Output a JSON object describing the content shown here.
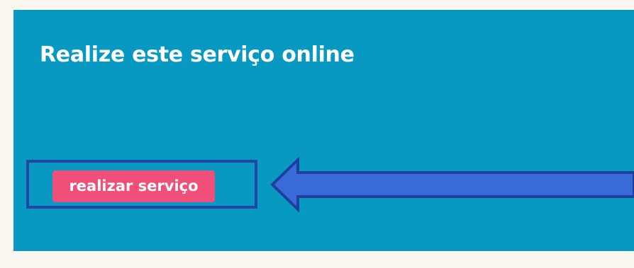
{
  "card": {
    "title": "Realize este serviço online",
    "background_color": "#0799c2"
  },
  "action": {
    "button_label": "realizar serviço",
    "button_color": "#ef4f78"
  },
  "annotation": {
    "highlight_color": "#2147a3",
    "arrow_fill_color": "#3a6ad8",
    "arrow_icon": "left-arrow-icon"
  }
}
